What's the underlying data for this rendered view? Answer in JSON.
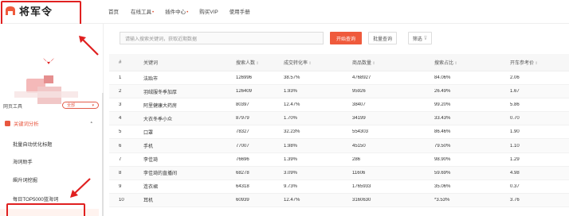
{
  "brand": {
    "name": "将军令",
    "accent": "#ef5a3c",
    "highlight": "#e02020"
  },
  "nav": {
    "items": [
      {
        "label": "首页",
        "dot": ""
      },
      {
        "label": "在线工具",
        "dot": "•"
      },
      {
        "label": "插件中心",
        "dot": "•"
      },
      {
        "label": "购买VIP",
        "dot": ""
      },
      {
        "label": "使用手册",
        "dot": ""
      }
    ]
  },
  "sidebar": {
    "tool_label": "网页工具",
    "tool_select_value": "全部",
    "group_label": "关键词分析",
    "group_caret": "▴",
    "items": [
      "批量自动优化标题",
      "海词助手",
      "飙升词挖掘",
      "每日TOP5000蓝海词"
    ]
  },
  "toolbar": {
    "search_placeholder": "请输入搜索关键词，获取近期数据",
    "start_button": "开始查询",
    "batch_button": "批量查询",
    "filter_button": "筛选"
  },
  "table": {
    "headers": [
      "#",
      "关键词",
      "搜索人数",
      "成交转化率",
      "商品数量",
      "搜索占比",
      "开车参考价"
    ],
    "sortable": [
      false,
      false,
      true,
      true,
      true,
      true,
      true
    ],
    "rows": [
      [
        "1",
        "法跆市",
        "126996",
        "38.57%",
        "4768927",
        "84.06%",
        "2.06"
      ],
      [
        "2",
        "羽绒服冬季加厚",
        "126409",
        "1.93%",
        "95926",
        "26.49%",
        "1.67"
      ],
      [
        "3",
        "阿里健康大药房",
        "80397",
        "12.47%",
        "38407",
        "99.20%",
        "5.86"
      ],
      [
        "4",
        "大衣冬季小众",
        "87979",
        "1.70%",
        "34199",
        "33.43%",
        "0.70"
      ],
      [
        "5",
        "口罩",
        "78327",
        "32.23%",
        "554303",
        "86.46%",
        "1.90"
      ],
      [
        "6",
        "手机",
        "77007",
        "1.98%",
        "45150",
        "79.50%",
        "1.10"
      ],
      [
        "7",
        "李佳琦",
        "76696",
        "1.39%",
        "286",
        "98.90%",
        "1.29"
      ],
      [
        "8",
        "李佳琦的直播间",
        "68278",
        "3.09%",
        "11606",
        "59.69%",
        "4.98"
      ],
      [
        "9",
        "连衣裙",
        "64318",
        "9.73%",
        "1765933",
        "35.06%",
        "0.37"
      ],
      [
        "10",
        "耳机",
        "60939",
        "12.47%",
        "3160630",
        "*3.53%",
        "3.76"
      ]
    ]
  }
}
